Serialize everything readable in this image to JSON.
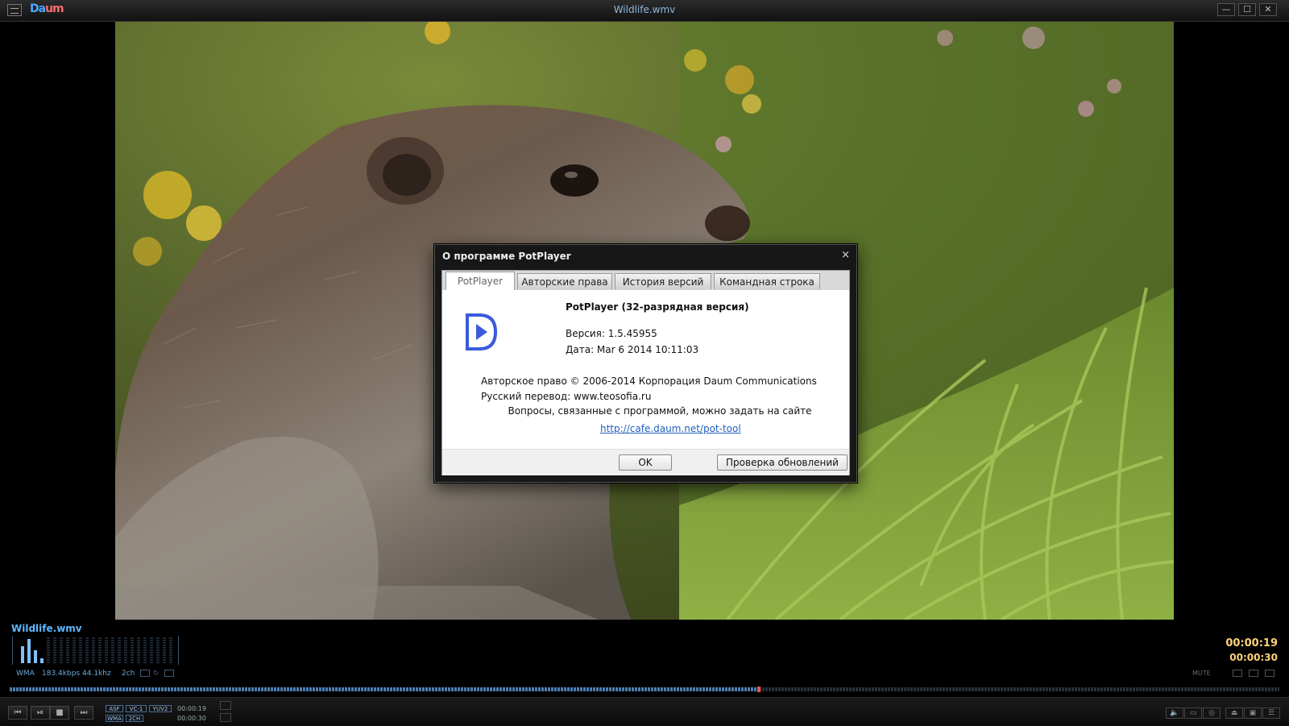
{
  "window": {
    "logo_main": "Da",
    "logo_accent": "um",
    "title": "Wildlife.wmv",
    "menu_icon": "menu-icon",
    "minimize_glyph": "—",
    "maximize_glyph": "☐",
    "close_glyph": "✕"
  },
  "dialog": {
    "title": "О программе PotPlayer",
    "close_glyph": "×",
    "tabs": [
      "PotPlayer",
      "Авторские права",
      "История версий",
      "Командная строка"
    ],
    "active_tab": "PotPlayer",
    "product": "PotPlayer (32-разрядная версия)",
    "version": "Версия: 1.5.45955",
    "date": "Дата: Mar  6 2014 10:11:03",
    "copyright": "Авторское право © 2006-2014 Корпорация Daum Communications",
    "translation": "Русский перевод: www.teosofia.ru",
    "questions": "Вопросы, связанные с программой, можно задать на сайте",
    "link": "http://cafe.daum.net/pot-tool",
    "ok_label": "OK",
    "update_label": "Проверка обновлений",
    "accent": "#3b5bdb"
  },
  "player": {
    "filename": "Wildlife.wmv",
    "time_current": "00:00:19",
    "time_total": "00:00:30",
    "codec": "WMA",
    "bitrate": "183.4kbps",
    "samplerate": "44.1khz",
    "channels": "2ch",
    "mute_label": "MUTE",
    "progress": 0.59,
    "eq_levels": [
      0.65,
      0.95,
      0.5,
      0.2
    ],
    "badges": {
      "asf": "ASF",
      "vc1": "VC-1",
      "yuv2": "YUV2",
      "wma": "WMA",
      "ch2": "2CH"
    },
    "small_time_current": "00:00:19",
    "small_time_total": "00:00:30",
    "accent": "#5fb8ff",
    "time_color": "#ffd27a"
  }
}
